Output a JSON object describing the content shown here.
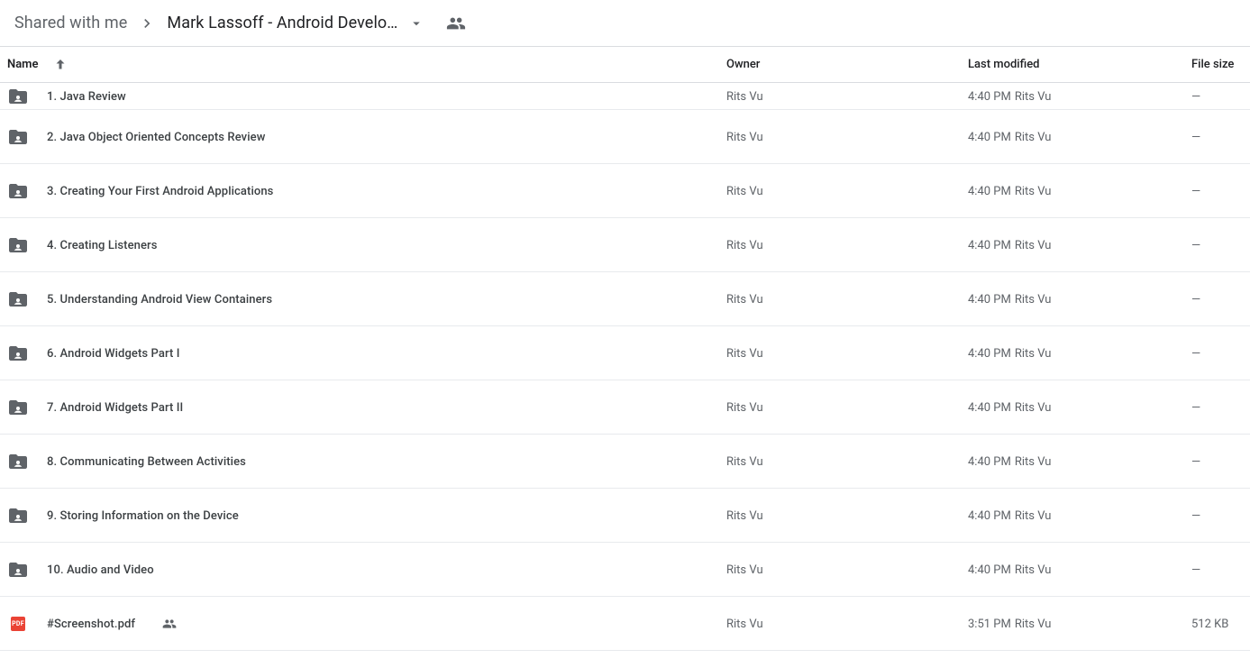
{
  "breadcrumb": {
    "root": "Shared with me",
    "current": "Mark Lassoff - Android Develo…"
  },
  "headers": {
    "name": "Name",
    "owner": "Owner",
    "modified": "Last modified",
    "size": "File size"
  },
  "rows": [
    {
      "type": "folder",
      "clipped": true,
      "name": "1. Java Review",
      "owner": "Rits Vu",
      "mod_time": "4:40 PM",
      "mod_by": "Rits Vu",
      "size": "—",
      "shared": false
    },
    {
      "type": "folder",
      "clipped": false,
      "name": "2. Java Object Oriented Concepts Review",
      "owner": "Rits Vu",
      "mod_time": "4:40 PM",
      "mod_by": "Rits Vu",
      "size": "—",
      "shared": false
    },
    {
      "type": "folder",
      "clipped": false,
      "name": "3. Creating Your First Android Applications",
      "owner": "Rits Vu",
      "mod_time": "4:40 PM",
      "mod_by": "Rits Vu",
      "size": "—",
      "shared": false
    },
    {
      "type": "folder",
      "clipped": false,
      "name": "4. Creating Listeners",
      "owner": "Rits Vu",
      "mod_time": "4:40 PM",
      "mod_by": "Rits Vu",
      "size": "—",
      "shared": false
    },
    {
      "type": "folder",
      "clipped": false,
      "name": "5. Understanding Android View Containers",
      "owner": "Rits Vu",
      "mod_time": "4:40 PM",
      "mod_by": "Rits Vu",
      "size": "—",
      "shared": false
    },
    {
      "type": "folder",
      "clipped": false,
      "name": "6. Android Widgets Part I",
      "owner": "Rits Vu",
      "mod_time": "4:40 PM",
      "mod_by": "Rits Vu",
      "size": "—",
      "shared": false
    },
    {
      "type": "folder",
      "clipped": false,
      "name": "7. Android Widgets Part II",
      "owner": "Rits Vu",
      "mod_time": "4:40 PM",
      "mod_by": "Rits Vu",
      "size": "—",
      "shared": false
    },
    {
      "type": "folder",
      "clipped": false,
      "name": "8. Communicating Between Activities",
      "owner": "Rits Vu",
      "mod_time": "4:40 PM",
      "mod_by": "Rits Vu",
      "size": "—",
      "shared": false
    },
    {
      "type": "folder",
      "clipped": false,
      "name": "9. Storing Information on the Device",
      "owner": "Rits Vu",
      "mod_time": "4:40 PM",
      "mod_by": "Rits Vu",
      "size": "—",
      "shared": false
    },
    {
      "type": "folder",
      "clipped": false,
      "name": "10. Audio and Video",
      "owner": "Rits Vu",
      "mod_time": "4:40 PM",
      "mod_by": "Rits Vu",
      "size": "—",
      "shared": false
    },
    {
      "type": "pdf",
      "clipped": false,
      "name": "#Screenshot.pdf",
      "owner": "Rits Vu",
      "mod_time": "3:51 PM",
      "mod_by": "Rits Vu",
      "size": "512 KB",
      "shared": true
    }
  ]
}
